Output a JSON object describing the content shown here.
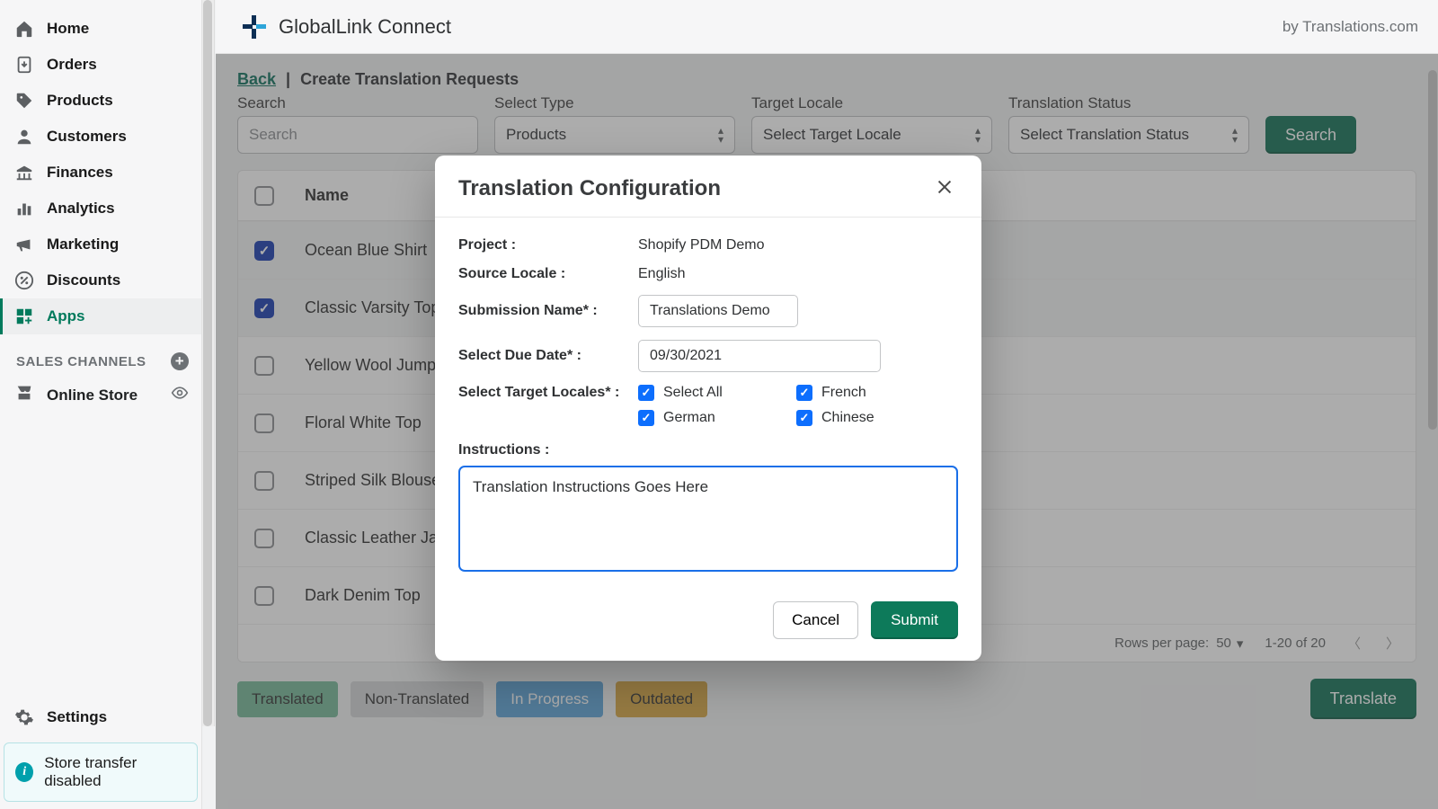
{
  "sidebar": {
    "items": [
      {
        "label": "Home",
        "icon": "home"
      },
      {
        "label": "Orders",
        "icon": "orders"
      },
      {
        "label": "Products",
        "icon": "tag"
      },
      {
        "label": "Customers",
        "icon": "user"
      },
      {
        "label": "Finances",
        "icon": "bank"
      },
      {
        "label": "Analytics",
        "icon": "bars"
      },
      {
        "label": "Marketing",
        "icon": "megaphone"
      },
      {
        "label": "Discounts",
        "icon": "percent"
      },
      {
        "label": "Apps",
        "icon": "grid"
      }
    ],
    "active_index": 8,
    "section_label": "SALES CHANNELS",
    "online_store": "Online Store",
    "settings": "Settings",
    "notice": "Store transfer disabled"
  },
  "header": {
    "app_name": "GlobalLink Connect",
    "byline": "by Translations.com"
  },
  "breadcrumb": {
    "back": "Back",
    "title": "Create Translation Requests"
  },
  "filters": {
    "search_label": "Search",
    "search_placeholder": "Search",
    "type_label": "Select Type",
    "type_value": "Products",
    "locale_label": "Target Locale",
    "locale_value": "Select Target Locale",
    "status_label": "Translation Status",
    "status_value": "Select Translation Status",
    "search_btn": "Search"
  },
  "table": {
    "name_header": "Name",
    "rows": [
      {
        "name": "Ocean Blue Shirt",
        "checked": true
      },
      {
        "name": "Classic Varsity Top",
        "checked": true
      },
      {
        "name": "Yellow Wool Jumper",
        "checked": false
      },
      {
        "name": "Floral White Top",
        "checked": false
      },
      {
        "name": "Striped Silk Blouse",
        "checked": false
      },
      {
        "name": "Classic Leather Jacket",
        "checked": false
      },
      {
        "name": "Dark Denim Top",
        "checked": false
      }
    ],
    "rows_per_page_label": "Rows per page:",
    "rows_per_page_value": "50",
    "range": "1-20 of 20"
  },
  "legend": {
    "translated": "Translated",
    "non_translated": "Non-Translated",
    "in_progress": "In Progress",
    "outdated": "Outdated",
    "translate_btn": "Translate"
  },
  "modal": {
    "title": "Translation Configuration",
    "project_label": "Project :",
    "project_value": "Shopify PDM Demo",
    "source_label": "Source Locale :",
    "source_value": "English",
    "submission_label": "Submission Name* :",
    "submission_value": "Translations Demo",
    "due_label": "Select Due Date* :",
    "due_value": "09/30/2021",
    "locales_label": "Select Target Locales* :",
    "locales": [
      "Select All",
      "French",
      "German",
      "Chinese"
    ],
    "instructions_label": "Instructions :",
    "instructions_value": "Translation Instructions Goes Here",
    "cancel": "Cancel",
    "submit": "Submit"
  }
}
